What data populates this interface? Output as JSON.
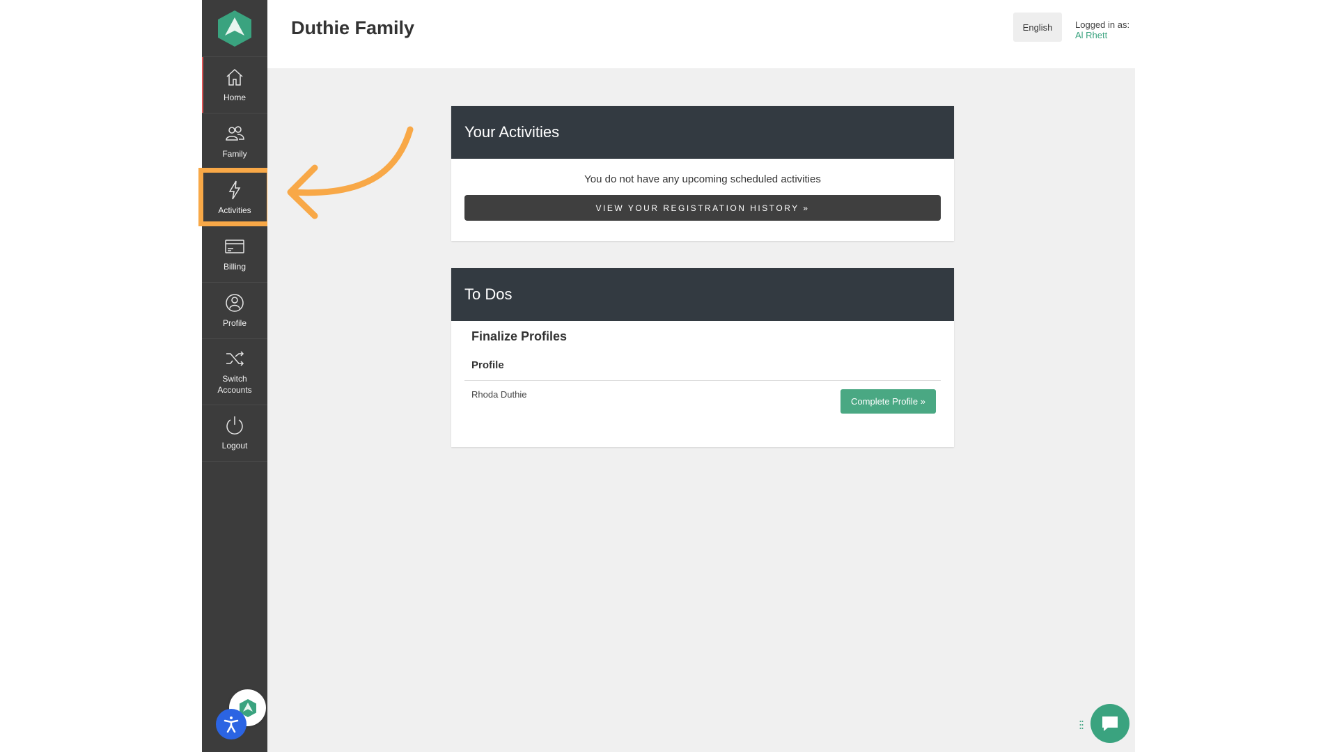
{
  "sidebar": {
    "items": [
      {
        "label": "Home",
        "icon": "home-icon"
      },
      {
        "label": "Family",
        "icon": "family-icon"
      },
      {
        "label": "Activities",
        "icon": "lightning-icon"
      },
      {
        "label": "Billing",
        "icon": "credit-card-icon"
      },
      {
        "label": "Profile",
        "icon": "profile-icon"
      },
      {
        "label": "Switch\nAccounts",
        "icon": "shuffle-icon"
      },
      {
        "label": "Logout",
        "icon": "power-icon"
      }
    ]
  },
  "header": {
    "title": "Duthie Family",
    "language": "English",
    "logged_in_prefix": "Logged in as:",
    "user_name": "Al Rhett"
  },
  "activities": {
    "title": "Your Activities",
    "empty_message": "You do not have any upcoming scheduled activities",
    "history_button": "VIEW YOUR REGISTRATION HISTORY »"
  },
  "todos": {
    "title": "To Dos",
    "section_title": "Finalize Profiles",
    "subsection": "Profile",
    "rows": [
      {
        "name": "Rhoda Duthie",
        "action": "Complete Profile »"
      }
    ]
  },
  "colors": {
    "sidebar_bg": "#3c3c3c",
    "card_header_bg": "#333a41",
    "accent_green": "#3aa37f",
    "highlight_orange": "#f8a847",
    "a11y_blue": "#2b64e3"
  }
}
